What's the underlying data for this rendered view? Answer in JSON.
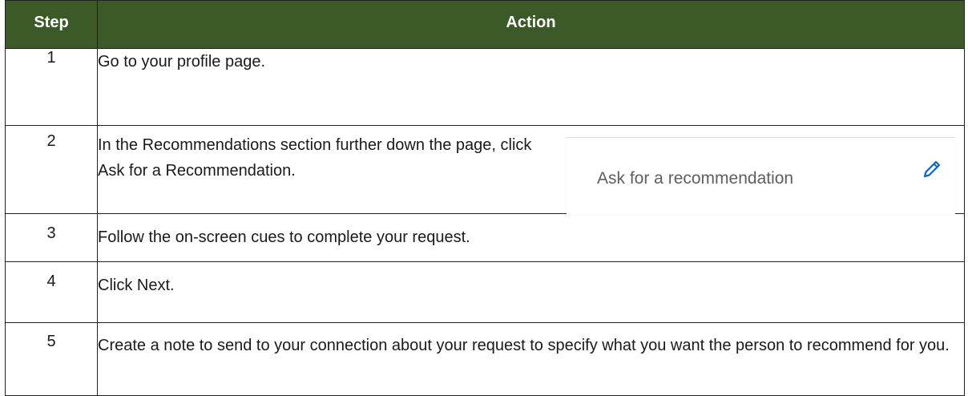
{
  "table": {
    "headers": {
      "step": "Step",
      "action": "Action"
    },
    "rows": [
      {
        "step": "1",
        "action": "Go to your profile page."
      },
      {
        "step": "2",
        "action": "In the Recommendations section further down the page, click Ask for a Recommendation."
      },
      {
        "step": "3",
        "action": "Follow the on-screen cues to complete your request."
      },
      {
        "step": "4",
        "action": "Click Next."
      },
      {
        "step": "5",
        "action": "Create a note to send to your connection about your request to specify what you want the person to recommend for you."
      }
    ]
  },
  "widget": {
    "label": "Ask for a recommendation",
    "icon": "pencil-icon"
  },
  "colors": {
    "header_bg": "#3b5a28",
    "header_text": "#ffffff",
    "icon_blue": "#0a66c2"
  }
}
